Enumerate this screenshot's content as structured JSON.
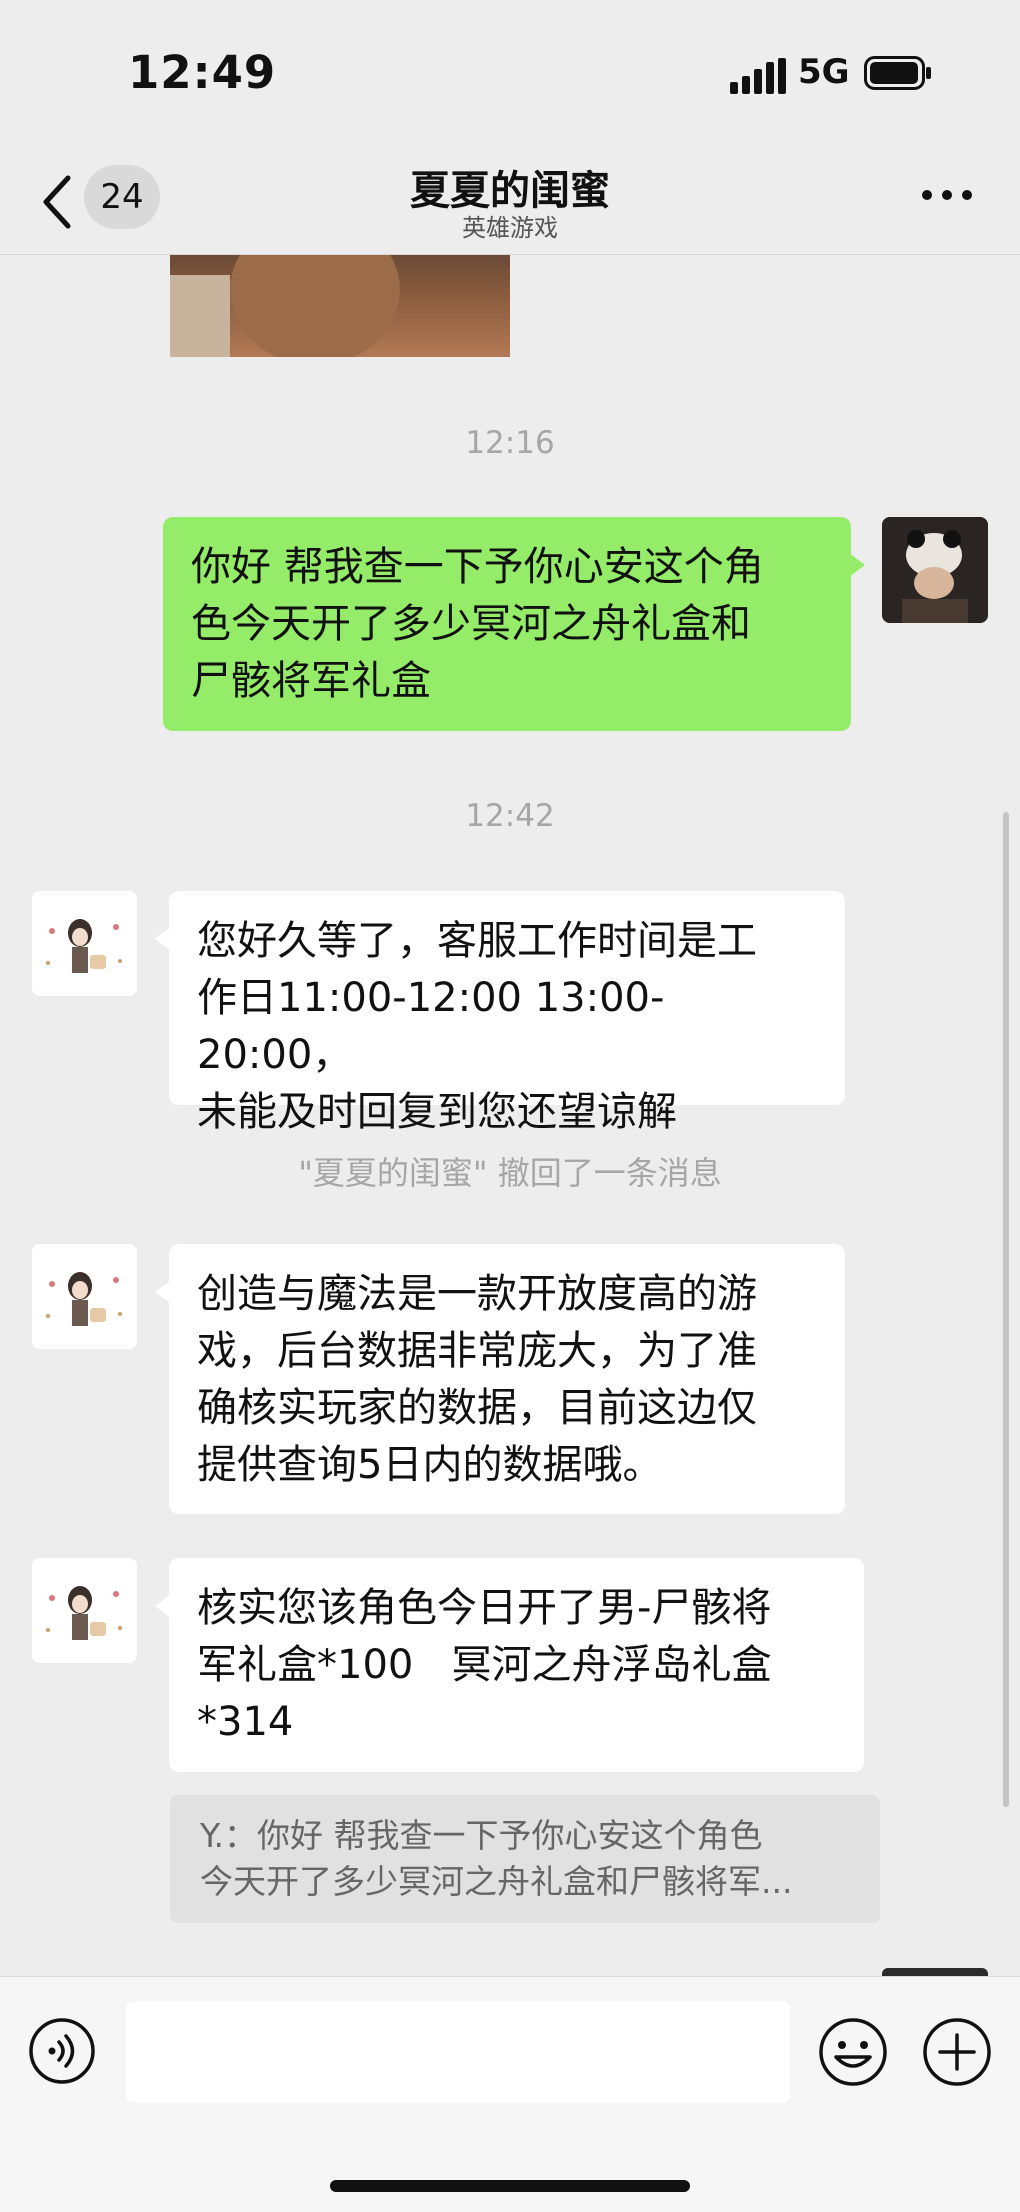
{
  "status_bar": {
    "time": "12:49",
    "network": "5G"
  },
  "nav": {
    "unread_count": "24",
    "title": "夏夏的闺蜜",
    "subtitle": "英雄游戏"
  },
  "chat": {
    "timestamps": [
      "12:16",
      "12:42"
    ],
    "messages": [
      {
        "sender": "me",
        "text": "你好 帮我查一下予你心安这个角\n色今天开了多少冥河之舟礼盒和\n尸骸将军礼盒"
      },
      {
        "sender": "other",
        "text": "您好久等了，客服工作时间是工\n作日11:00-12:00 13:00-20:00，\n未能及时回复到您还望谅解"
      },
      {
        "sender": "other",
        "text": "创造与魔法是一款开放度高的游\n戏，后台数据非常庞大，为了准\n确核实玩家的数据，目前这边仅\n提供查询5日内的数据哦。"
      },
      {
        "sender": "other",
        "text": "核实您该角色今日开了男-尸骸将\n军礼盒*100   冥河之舟浮岛礼盒\n*314"
      }
    ],
    "recall_notice": "\"夏夏的闺蜜\" 撤回了一条消息",
    "quote": {
      "line1": "Y.：你好 帮我查一下予你心安这个角色",
      "line2": "今天开了多少冥河之舟礼盒和尸骸将军..."
    }
  },
  "input": {
    "text": ""
  },
  "colors": {
    "bubble_me": "#95ec69",
    "bubble_other": "#ffffff",
    "background": "#ededed"
  },
  "icons": [
    "chevron-left-icon",
    "more-icon",
    "voice-icon",
    "emoji-icon",
    "plus-icon",
    "signal-icon",
    "battery-icon"
  ]
}
